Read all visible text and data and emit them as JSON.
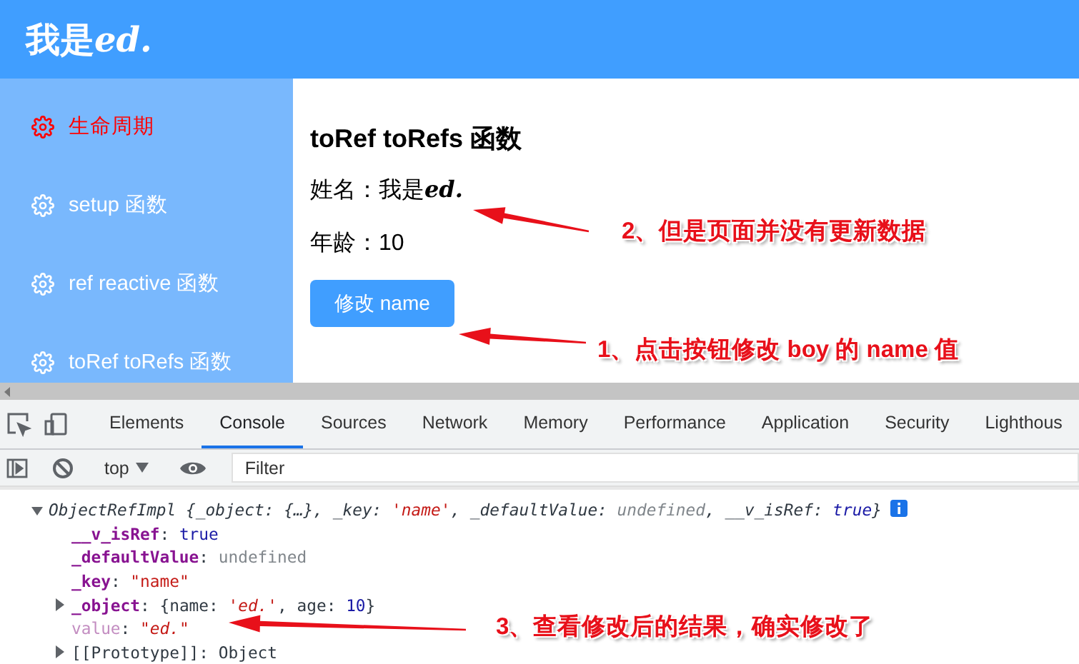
{
  "app": {
    "title": {
      "text": "我是",
      "emphasis": "ed."
    },
    "sidebar": {
      "items": [
        {
          "label": "生命周期",
          "selected": true
        },
        {
          "label": "setup 函数",
          "selected": false
        },
        {
          "label": "ref reactive 函数",
          "selected": false
        },
        {
          "label": "toRef toRefs 函数",
          "selected": false
        }
      ]
    },
    "content": {
      "heading": "toRef toRefs 函数",
      "name_line": {
        "text": "姓名：我是",
        "emphasis": "ed."
      },
      "age_line": "年龄：10",
      "button": "修改 name"
    }
  },
  "devtools": {
    "tabs": [
      {
        "label": "Elements",
        "selected": false
      },
      {
        "label": "Console",
        "selected": true
      },
      {
        "label": "Sources",
        "selected": false
      },
      {
        "label": "Network",
        "selected": false
      },
      {
        "label": "Memory",
        "selected": false
      },
      {
        "label": "Performance",
        "selected": false
      },
      {
        "label": "Application",
        "selected": false
      },
      {
        "label": "Security",
        "selected": false
      },
      {
        "label": "Lighthous",
        "selected": false
      }
    ],
    "context": "top",
    "filter": {
      "placeholder": "Filter"
    },
    "console": [
      {
        "expanded": true,
        "italic": true,
        "info_icon": true,
        "segments": [
          {
            "text": "ObjectRefImpl {_object: {…}, _key: ",
            "kind": "plain"
          },
          {
            "text": "'name'",
            "kind": "string"
          },
          {
            "text": ", _defaultValue: ",
            "kind": "plain"
          },
          {
            "text": "undefined",
            "kind": "undefined"
          },
          {
            "text": ", __v_isRef: ",
            "kind": "plain"
          },
          {
            "text": "true",
            "kind": "keyword"
          },
          {
            "text": "}",
            "kind": "plain"
          }
        ],
        "children": [
          {
            "segments": [
              {
                "text": "__v_isRef",
                "kind": "key"
              },
              {
                "text": ": ",
                "kind": "plain"
              },
              {
                "text": "true",
                "kind": "keyword"
              }
            ]
          },
          {
            "segments": [
              {
                "text": "_defaultValue",
                "kind": "key"
              },
              {
                "text": ": ",
                "kind": "plain"
              },
              {
                "text": "undefined",
                "kind": "undefined"
              }
            ]
          },
          {
            "segments": [
              {
                "text": "_key",
                "kind": "key"
              },
              {
                "text": ": ",
                "kind": "plain"
              },
              {
                "text": "\"name\"",
                "kind": "string"
              }
            ]
          },
          {
            "expanded": false,
            "segments": [
              {
                "text": "_object",
                "kind": "key"
              },
              {
                "text": ": {name: ",
                "kind": "plain"
              },
              {
                "text": "'ed.'",
                "kind": "preview_string"
              },
              {
                "text": ", age: ",
                "kind": "plain"
              },
              {
                "text": "10",
                "kind": "number"
              },
              {
                "text": "}",
                "kind": "plain"
              }
            ]
          },
          {
            "segments": [
              {
                "text": "value",
                "kind": "getter"
              },
              {
                "text": ": ",
                "kind": "plain"
              },
              {
                "text": "\"ed.\"",
                "kind": "preview_string"
              }
            ]
          },
          {
            "expanded": false,
            "segments": [
              {
                "text": "[[Prototype]]",
                "kind": "internal"
              },
              {
                "text": ": Object",
                "kind": "plain"
              }
            ]
          }
        ]
      }
    ]
  },
  "annotations": [
    {
      "text": "2、但是页面并没有更新数据"
    },
    {
      "text": "1、点击按钮修改 boy 的 name 值"
    },
    {
      "text": "3、查看修改后的结果，确实修改了"
    }
  ]
}
